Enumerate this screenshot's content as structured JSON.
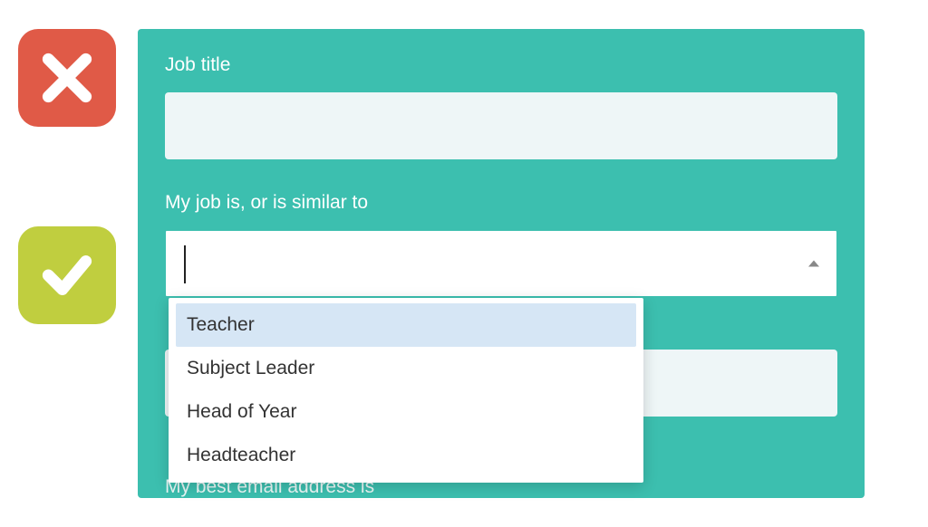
{
  "icons": {
    "cross": "cross-icon",
    "check": "check-icon"
  },
  "form": {
    "job_title": {
      "label": "Job title",
      "value": ""
    },
    "job_similar": {
      "label": "My job is, or is similar to",
      "value": "",
      "options": [
        "Teacher",
        "Subject Leader",
        "Head of Year",
        "Headteacher"
      ],
      "highlighted_index": 0
    },
    "partial_label": "My best email address is"
  },
  "colors": {
    "panel_bg": "#3cbfaf",
    "cross_bg": "#e05a47",
    "check_bg": "#c0ce3f",
    "highlight_bg": "#d6e6f5",
    "input_bg": "#eef6f7"
  }
}
